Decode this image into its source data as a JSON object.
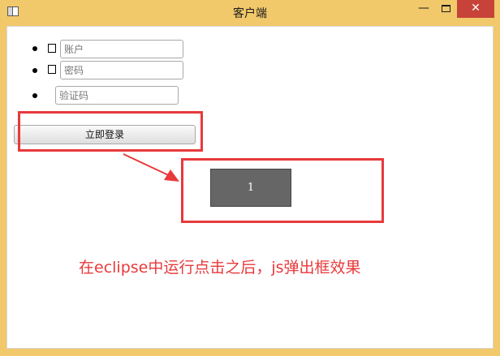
{
  "window": {
    "title": "客户端",
    "minimize_label": "—",
    "close_label": "✕"
  },
  "form": {
    "account_placeholder": "账户",
    "password_placeholder": "密码",
    "captcha_placeholder": "验证码",
    "login_label": "立即登录"
  },
  "popup": {
    "message": "1"
  },
  "annotation": {
    "text": "在eclipse中运行点击之后，js弹出框效果",
    "color": "#e8393b"
  },
  "icons": {
    "app": "window-icon",
    "minimize": "minimize-icon",
    "maximize": "maximize-icon",
    "close": "close-icon"
  }
}
